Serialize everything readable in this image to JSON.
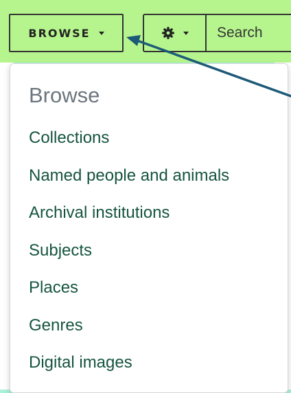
{
  "toolbar": {
    "browse_label": "BROWSE",
    "settings_icon": "gear-icon",
    "search_placeholder": "Search"
  },
  "dropdown": {
    "header": "Browse",
    "items": [
      {
        "label": "Collections"
      },
      {
        "label": "Named people and animals"
      },
      {
        "label": "Archival institutions"
      },
      {
        "label": "Subjects"
      },
      {
        "label": "Places"
      },
      {
        "label": "Genres"
      },
      {
        "label": "Digital images"
      }
    ]
  },
  "colors": {
    "toolbar_bg": "#b6f58e",
    "page_bg": "#a9f2d9",
    "link_color": "#15543f",
    "header_color": "#6c757d",
    "arrow_color": "#1c5a78"
  }
}
